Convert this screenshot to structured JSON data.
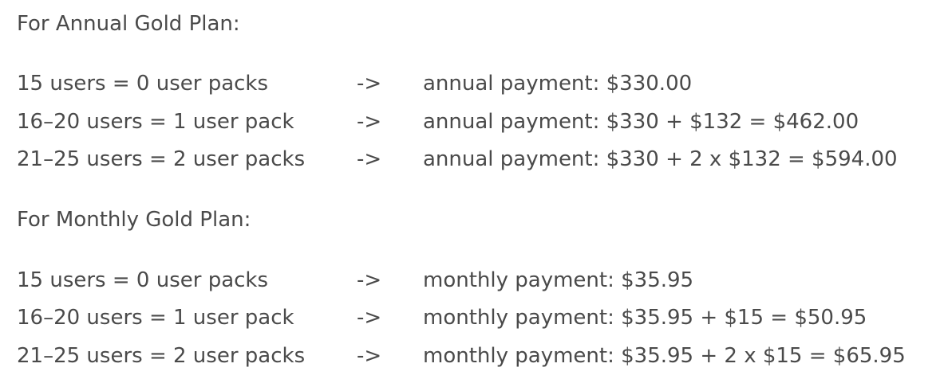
{
  "annual": {
    "heading": "For Annual Gold Plan:",
    "rows": [
      {
        "users": "15 users = 0 user packs",
        "arrow": "->",
        "payment": "annual payment: $330.00"
      },
      {
        "users": "16–20 users = 1 user pack",
        "arrow": "->",
        "payment": "annual payment: $330 + $132 = $462.00"
      },
      {
        "users": "21–25 users = 2 user packs",
        "arrow": "->",
        "payment": "annual payment: $330 + 2 x $132 = $594.00"
      }
    ]
  },
  "monthly": {
    "heading": "For Monthly Gold Plan:",
    "rows": [
      {
        "users": "15 users = 0 user packs",
        "arrow": "->",
        "payment": "monthly payment: $35.95"
      },
      {
        "users": "16–20 users = 1 user pack",
        "arrow": "->",
        "payment": "monthly payment: $35.95 + $15 = $50.95"
      },
      {
        "users": "21–25 users = 2 user packs",
        "arrow": "->",
        "payment": "monthly payment: $35.95 + 2 x $15 = $65.95"
      }
    ]
  }
}
